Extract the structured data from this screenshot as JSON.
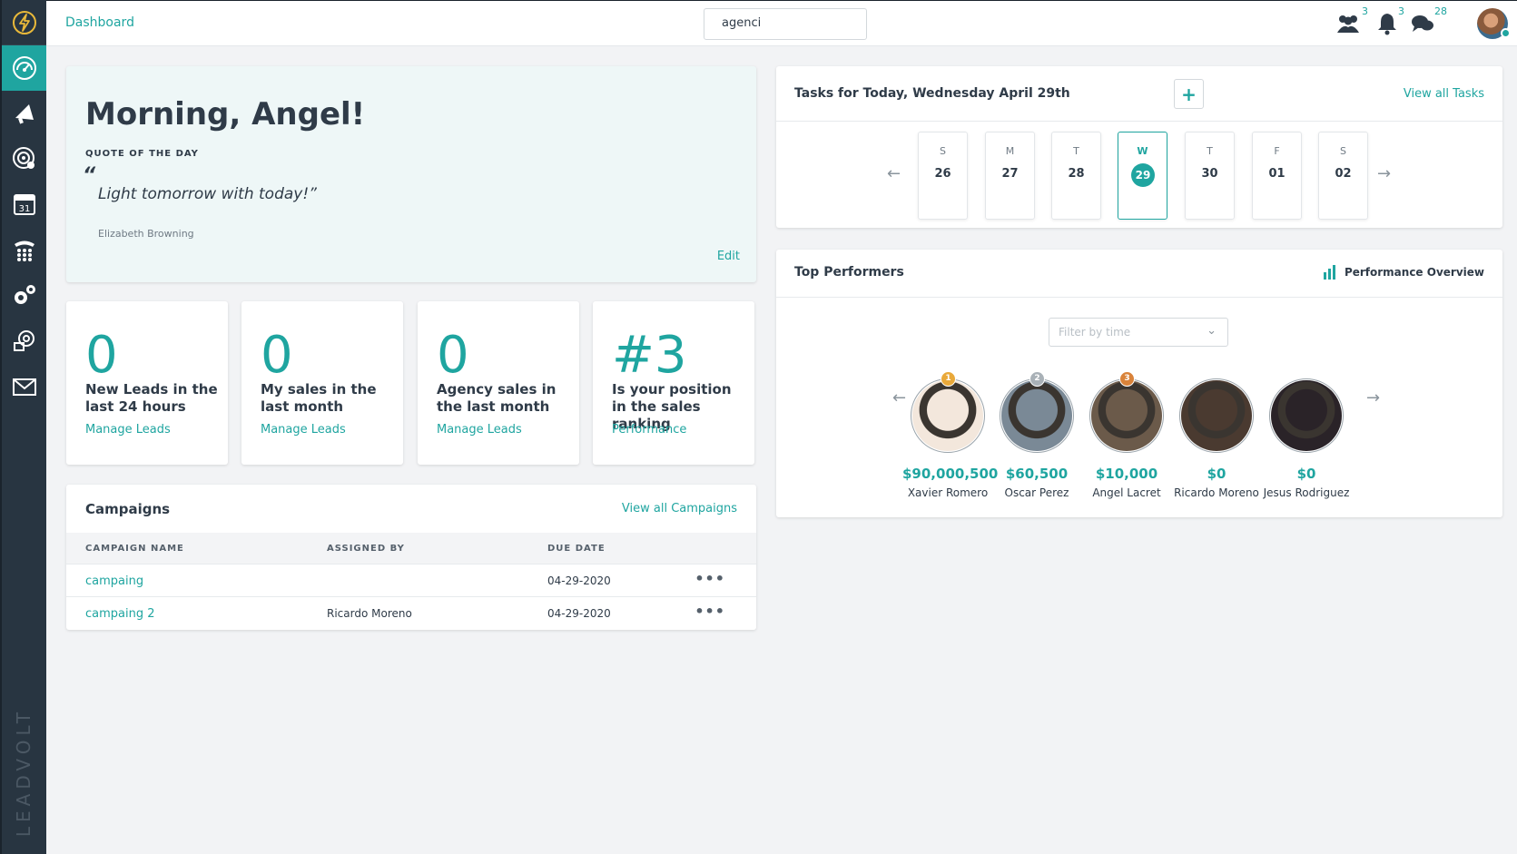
{
  "sidebar": {
    "brand": "LEADVOLT",
    "items": [
      {
        "icon": "dashboard-gauge-icon",
        "active": true
      },
      {
        "icon": "megaphone-icon"
      },
      {
        "icon": "target-icon"
      },
      {
        "icon": "calendar-icon",
        "text": "31"
      },
      {
        "icon": "phone-dialpad-icon"
      },
      {
        "icon": "gears-icon"
      },
      {
        "icon": "settings-cog-icon"
      },
      {
        "icon": "mail-icon"
      }
    ]
  },
  "topbar": {
    "breadcrumb": "Dashboard",
    "search_value": "agenci",
    "team_count": "3",
    "notifications_count": "3",
    "messages_count": "28"
  },
  "welcome": {
    "greeting": "Morning, Angel!",
    "quote_label": "QUOTE OF THE DAY",
    "quote_mark": "“",
    "quote": "Light tomorrow with today!”",
    "author": "Elizabeth Browning",
    "edit_label": "Edit"
  },
  "stats": [
    {
      "value": "0",
      "desc": "New Leads in the last 24 hours",
      "link": "Manage Leads"
    },
    {
      "value": "0",
      "desc": "My sales in the last month",
      "link": "Manage Leads"
    },
    {
      "value": "0",
      "desc": "Agency sales in the last month",
      "link": "Manage Leads"
    },
    {
      "value": "#3",
      "desc": "Is your position in the sales ranking",
      "link": "Performance"
    }
  ],
  "campaigns": {
    "title": "Campaigns",
    "view_all": "View all Campaigns",
    "columns": [
      "CAMPAIGN NAME",
      "ASSIGNED BY",
      "DUE DATE"
    ],
    "rows": [
      {
        "name": "campaing",
        "assigned_by": "",
        "due": "04-29-2020",
        "more": "•••"
      },
      {
        "name": "campaing 2",
        "assigned_by": "Ricardo Moreno",
        "due": "04-29-2020",
        "more": "•••"
      }
    ]
  },
  "tasks": {
    "title": "Tasks for Today, Wednesday April 29th",
    "add": "+",
    "view_all": "View all Tasks",
    "prev": "←",
    "next": "→",
    "days": [
      {
        "d": "S",
        "n": "26"
      },
      {
        "d": "M",
        "n": "27"
      },
      {
        "d": "T",
        "n": "28"
      },
      {
        "d": "W",
        "n": "29",
        "selected": true
      },
      {
        "d": "T",
        "n": "30"
      },
      {
        "d": "F",
        "n": "01"
      },
      {
        "d": "S",
        "n": "02"
      }
    ]
  },
  "performers": {
    "title": "Top Performers",
    "overview": "Performance Overview",
    "filter_placeholder": "Filter by time",
    "prev": "←",
    "next": "→",
    "people": [
      {
        "amount": "$90,000,500",
        "name": "Xavier Romero",
        "rank": "1",
        "medal_color": "#e9a93a",
        "face_color": "#f3e7dc"
      },
      {
        "amount": "$60,500",
        "name": "Oscar Perez",
        "rank": "2",
        "medal_color": "#a9b1b7",
        "face_color": "#7a8996"
      },
      {
        "amount": "$10,000",
        "name": "Angel Lacret",
        "rank": "3",
        "medal_color": "#d9833a",
        "face_color": "#6b5a4a"
      },
      {
        "amount": "$0",
        "name": "Ricardo Moreno",
        "rank": "",
        "face_color": "#4a3a30"
      },
      {
        "amount": "$0",
        "name": "Jesus Rodriguez",
        "rank": "",
        "face_color": "#2a2328"
      }
    ]
  },
  "colors": {
    "accent": "#1fa5a0",
    "sidebar": "#283541"
  }
}
